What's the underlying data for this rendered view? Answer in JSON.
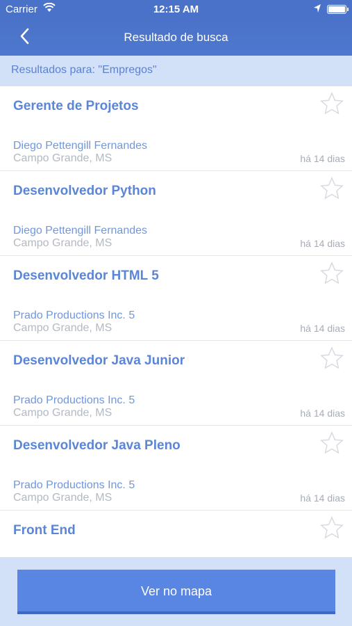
{
  "status_bar": {
    "carrier": "Carrier",
    "time": "12:15 AM"
  },
  "nav": {
    "title": "Resultado de busca",
    "back_icon": "chevron-left-icon"
  },
  "results_label": "Resultados para: \"Empregos\"",
  "jobs": [
    {
      "title": "Gerente de Projetos",
      "company": "Diego Pettengill Fernandes",
      "city": "Campo Grande, MS",
      "age": "há 14 dias"
    },
    {
      "title": "Desenvolvedor Python",
      "company": "Diego Pettengill Fernandes",
      "city": "Campo Grande, MS",
      "age": "há 14 dias"
    },
    {
      "title": "Desenvolvedor HTML 5",
      "company": "Prado Productions Inc. 5",
      "city": "Campo Grande, MS",
      "age": "há 14 dias"
    },
    {
      "title": "Desenvolvedor Java Junior",
      "company": "Prado Productions Inc. 5",
      "city": "Campo Grande, MS",
      "age": "há 14 dias"
    },
    {
      "title": "Desenvolvedor Java Pleno",
      "company": "Prado Productions Inc. 5",
      "city": "Campo Grande, MS",
      "age": "há 14 dias"
    },
    {
      "title": "Front End"
    }
  ],
  "map_button": "Ver no mapa",
  "colors": {
    "primary": "#4a72c8",
    "accent": "#5b86d6",
    "header_bg": "#d3e1f8",
    "button": "#5a86e3"
  }
}
